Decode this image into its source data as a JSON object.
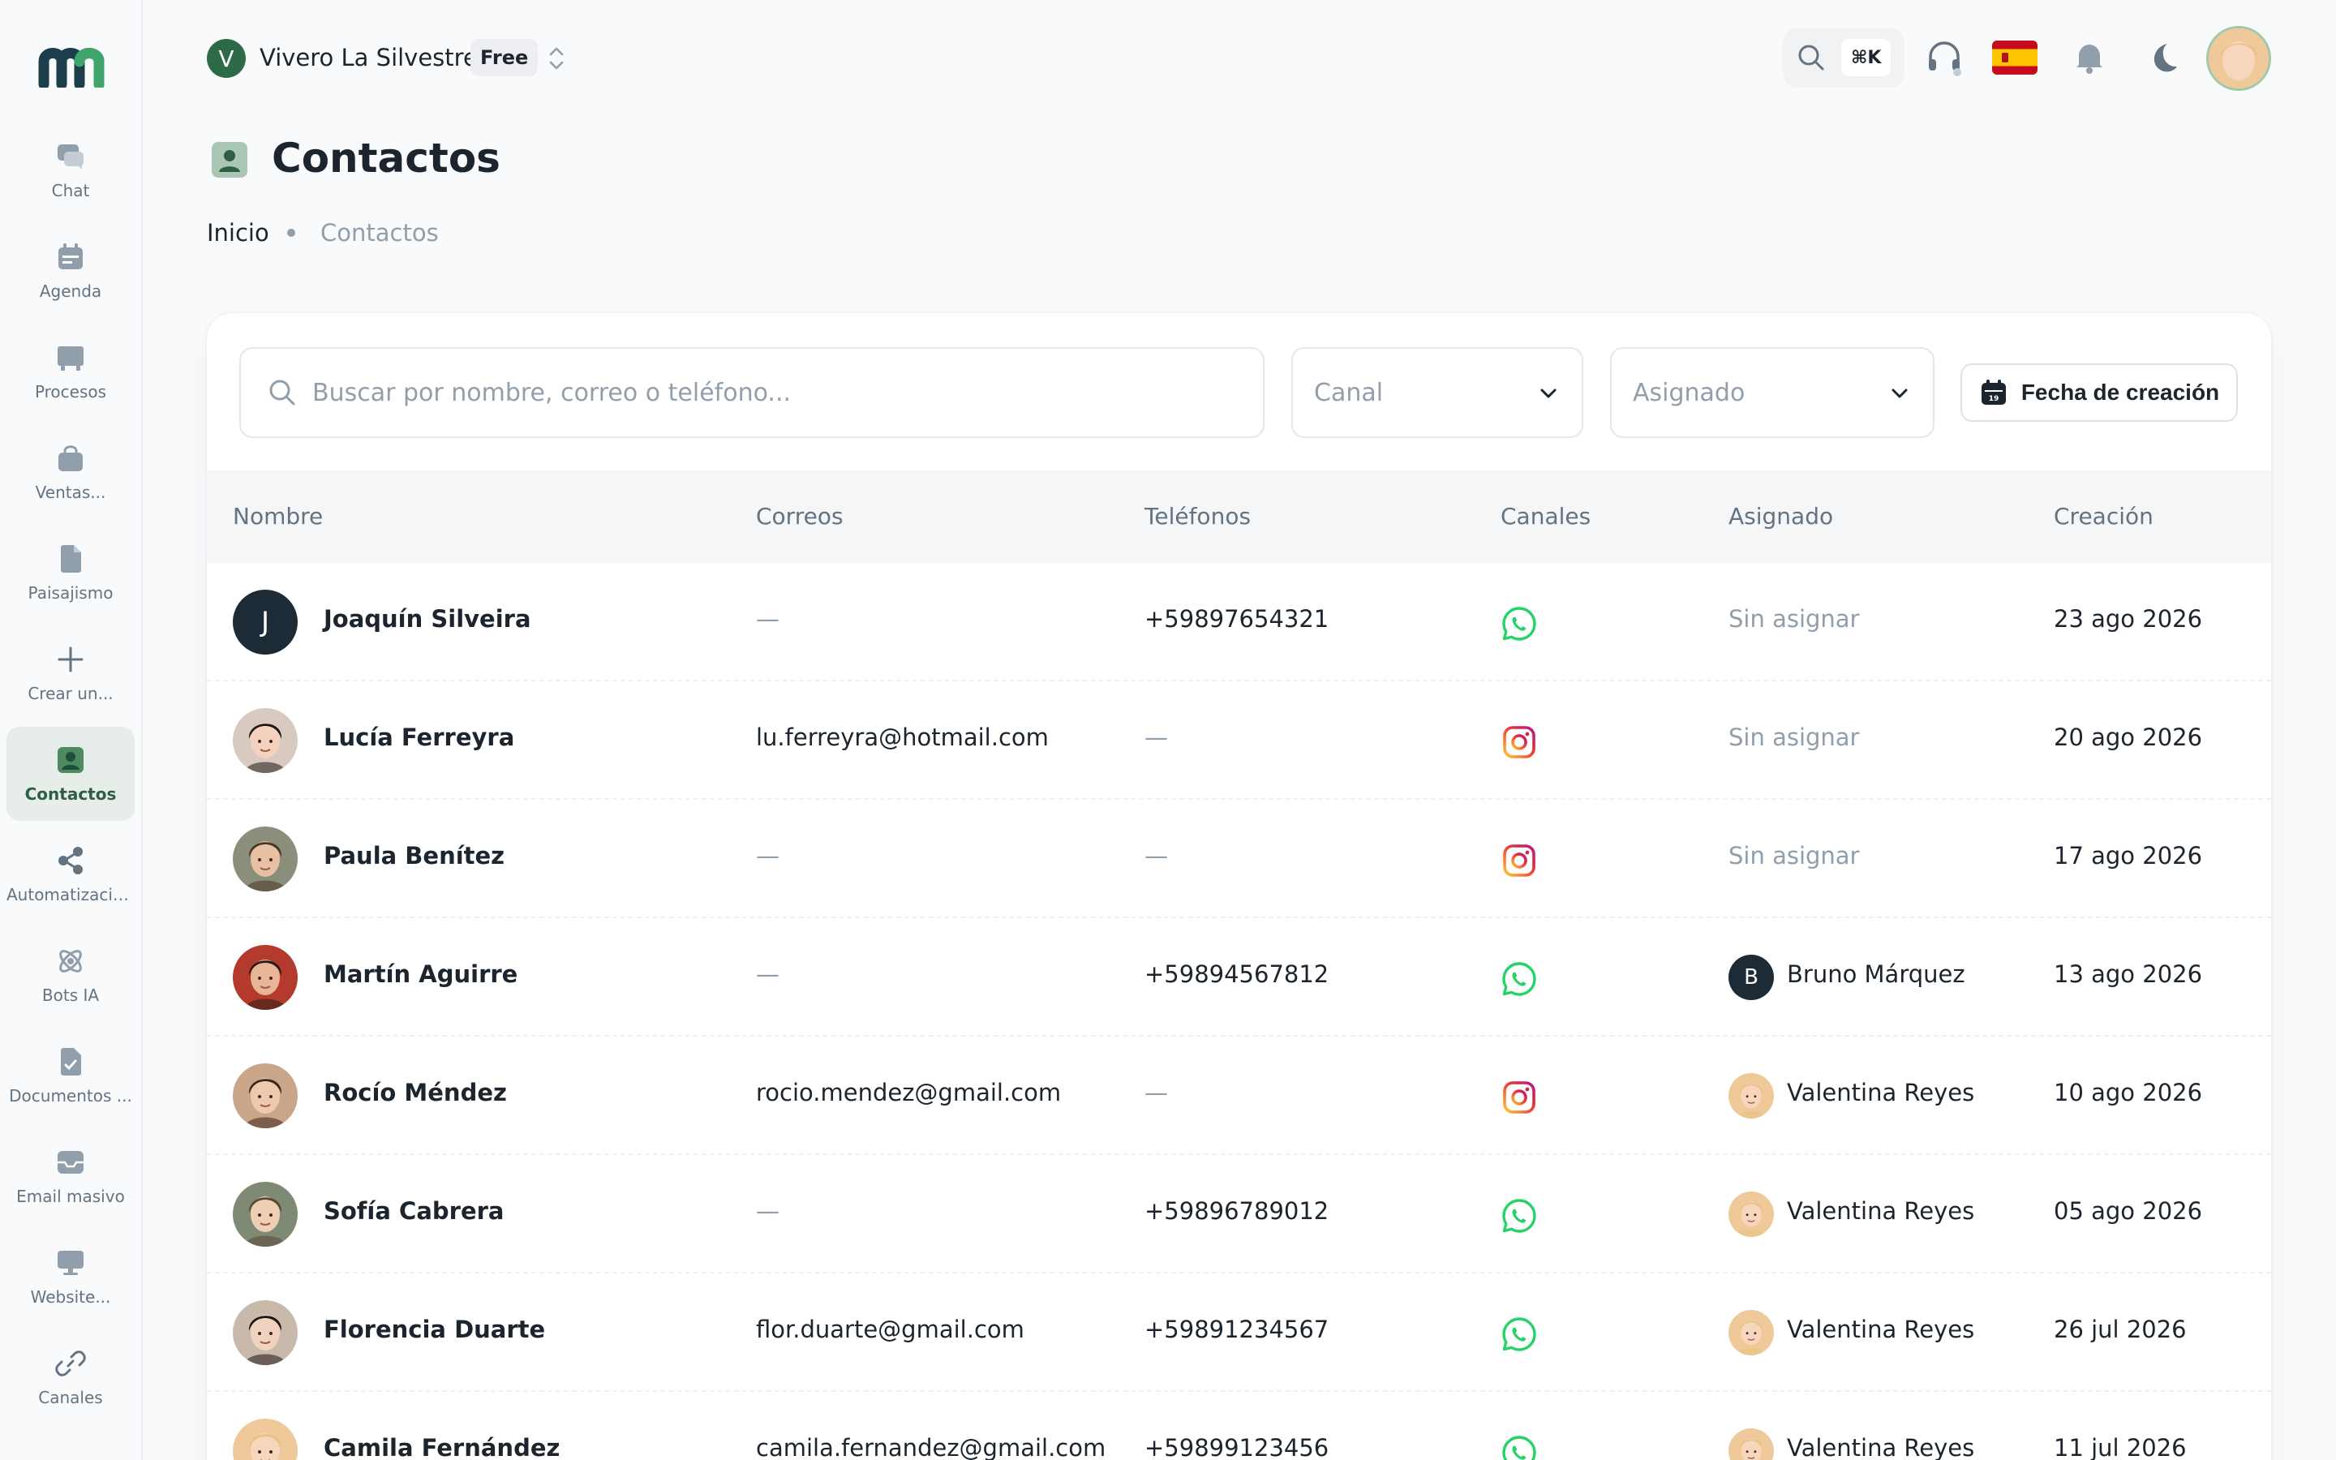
{
  "sidebar": {
    "items": [
      {
        "label": "Chat",
        "icon": "chat-icon"
      },
      {
        "label": "Agenda",
        "icon": "calendar-icon"
      },
      {
        "label": "Procesos",
        "icon": "kanban-icon"
      },
      {
        "label": "Ventas...",
        "icon": "shopping-bag-icon"
      },
      {
        "label": "Paisajismo",
        "icon": "document-icon"
      },
      {
        "label": "Crear un...",
        "icon": "plus-icon"
      },
      {
        "label": "Contactos",
        "icon": "contact-icon",
        "active": true
      },
      {
        "label": "Automatizaciones",
        "icon": "share-nodes-icon"
      },
      {
        "label": "Bots IA",
        "icon": "atom-icon"
      },
      {
        "label": "Documentos ...",
        "icon": "file-check-icon"
      },
      {
        "label": "Email masivo",
        "icon": "inbox-icon"
      },
      {
        "label": "Website...",
        "icon": "monitor-icon"
      },
      {
        "label": "Canales",
        "icon": "link-icon"
      }
    ]
  },
  "header": {
    "workspace_initial": "V",
    "workspace_name": "Vivero La Silvestre",
    "plan_badge": "Free",
    "search_shortcut": "⌘K",
    "language_flag": "es"
  },
  "page": {
    "title": "Contactos",
    "breadcrumb": [
      "Inicio",
      "Contactos"
    ]
  },
  "filters": {
    "search_placeholder": "Buscar por nombre, correo o teléfono...",
    "canal_placeholder": "Canal",
    "asignado_placeholder": "Asignado",
    "date_button": "Fecha de creación"
  },
  "table": {
    "columns": [
      "Nombre",
      "Correos",
      "Teléfonos",
      "Canales",
      "Asignado",
      "Creación"
    ],
    "rows": [
      {
        "avatar": "J",
        "name": "Joaquín Silveira",
        "email": "—",
        "phone": "+59897654321",
        "channel": "whatsapp",
        "assigned": "Sin asignar",
        "assigned_avatar": "",
        "created": "23 ago 2026"
      },
      {
        "avatar": "photo",
        "name": "Lucía Ferreyra",
        "email": "lu.ferreyra@hotmail.com",
        "phone": "—",
        "channel": "instagram",
        "assigned": "Sin asignar",
        "assigned_avatar": "",
        "created": "20 ago 2026"
      },
      {
        "avatar": "photo",
        "name": "Paula Benítez",
        "email": "—",
        "phone": "—",
        "channel": "instagram",
        "assigned": "Sin asignar",
        "assigned_avatar": "",
        "created": "17 ago 2026"
      },
      {
        "avatar": "photo",
        "name": "Martín Aguirre",
        "email": "—",
        "phone": "+59894567812",
        "channel": "whatsapp",
        "assigned": "Bruno Márquez",
        "assigned_avatar": "B",
        "created": "13 ago 2026"
      },
      {
        "avatar": "photo",
        "name": "Rocío Méndez",
        "email": "rocio.mendez@gmail.com",
        "phone": "—",
        "channel": "instagram",
        "assigned": "Valentina Reyes",
        "assigned_avatar": "photo",
        "created": "10 ago 2026"
      },
      {
        "avatar": "photo",
        "name": "Sofía Cabrera",
        "email": "—",
        "phone": "+59896789012",
        "channel": "whatsapp",
        "assigned": "Valentina Reyes",
        "assigned_avatar": "photo",
        "created": "05 ago 2026"
      },
      {
        "avatar": "photo",
        "name": "Florencia Duarte",
        "email": "flor.duarte@gmail.com",
        "phone": "+59891234567",
        "channel": "whatsapp",
        "assigned": "Valentina Reyes",
        "assigned_avatar": "photo",
        "created": "26 jul 2026"
      },
      {
        "avatar": "photo",
        "name": "Camila Fernández",
        "email": "camila.fernandez@gmail.com",
        "phone": "+59899123456",
        "channel": "whatsapp",
        "assigned": "Valentina Reyes",
        "assigned_avatar": "photo",
        "created": "11 jul 2026"
      }
    ]
  },
  "colors": {
    "brand": "#1f4d3a",
    "accent": "#2d6a48",
    "whatsapp": "#25d366",
    "muted_text": "#919eab"
  }
}
